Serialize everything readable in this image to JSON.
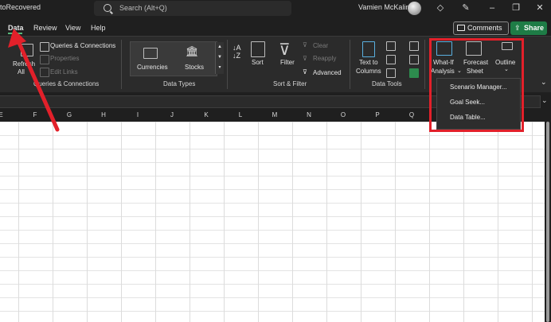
{
  "app": {
    "title_fragment": "toRecovered",
    "search_placeholder": "Search (Alt+Q)",
    "user": "Vamien McKalin"
  },
  "tabs": [
    {
      "label": "Data",
      "active": true
    },
    {
      "label": "Review"
    },
    {
      "label": "View"
    },
    {
      "label": "Help"
    }
  ],
  "actions": {
    "comments": "Comments",
    "share": "Share"
  },
  "ribbon": {
    "queries": {
      "refresh_line1": "Refresh",
      "refresh_line2": "All",
      "queries_connections": "Queries & Connections",
      "properties": "Properties",
      "edit_links": "Edit Links",
      "group": "Queries & Connections"
    },
    "data_types": {
      "currencies": "Currencies",
      "stocks": "Stocks",
      "group": "Data Types"
    },
    "sort_filter": {
      "sort": "Sort",
      "filter": "Filter",
      "clear": "Clear",
      "reapply": "Reapply",
      "advanced": "Advanced",
      "group": "Sort & Filter"
    },
    "data_tools": {
      "text_to_columns_1": "Text to",
      "text_to_columns_2": "Columns",
      "group": "Data Tools"
    },
    "forecast": {
      "what_if_1": "What-If",
      "what_if_2": "Analysis",
      "forecast_1": "Forecast",
      "forecast_2": "Sheet",
      "outline": "Outline"
    }
  },
  "whatif_menu": [
    "Scenario Manager...",
    "Goal Seek...",
    "Data Table..."
  ],
  "columns": [
    "E",
    "F",
    "G",
    "H",
    "I",
    "J",
    "K",
    "L",
    "M",
    "N",
    "O",
    "P",
    "Q"
  ],
  "colors": {
    "highlight": "#e2202a",
    "share": "#1e7c46",
    "active_tab": "#56b87a"
  }
}
